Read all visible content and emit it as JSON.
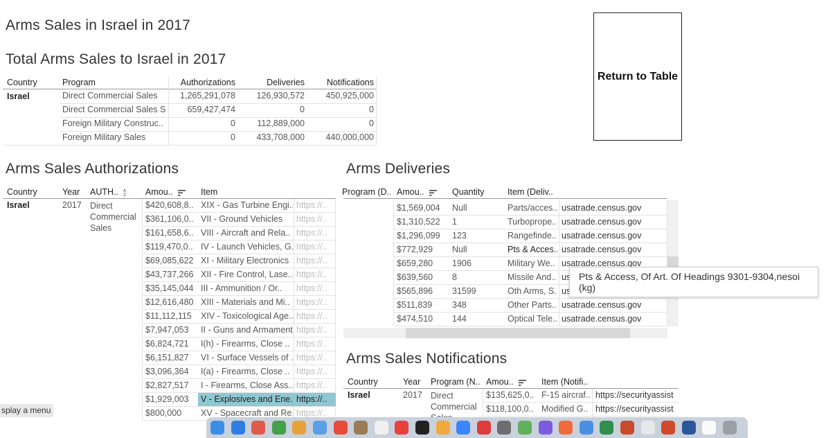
{
  "page_title": "Arms Sales in Israel in 2017",
  "return_button": "Return to Table",
  "total": {
    "title": "Total Arms Sales to Israel in 2017",
    "headers": [
      "Country",
      "Program",
      "Authorizations",
      "Deliveries",
      "Notifications"
    ],
    "country": "Israel",
    "rows": [
      {
        "program": "Direct Commercial Sales",
        "auth": "1,265,291,078",
        "deliv": "126,930,572",
        "notif": "450,925,000"
      },
      {
        "program": "Direct Commercial Sales S..",
        "auth": "659,427,474",
        "deliv": "0",
        "notif": "0"
      },
      {
        "program": "Foreign Military Construc..",
        "auth": "0",
        "deliv": "112,889,000",
        "notif": "0"
      },
      {
        "program": "Foreign Military Sales",
        "auth": "0",
        "deliv": "433,708,000",
        "notif": "440,000,000"
      }
    ]
  },
  "authorizations": {
    "title": "Arms Sales Authorizations",
    "headers": {
      "country": "Country",
      "year": "Year",
      "auth": "AUTH..",
      "amount": "Amou..",
      "item": "Item"
    },
    "country": "Israel",
    "year": "2017",
    "program_lines": [
      "Direct",
      "Commercial",
      "Sales"
    ],
    "rows": [
      {
        "amount": "$420,608,8..",
        "item": "XIX - Gas Turbine Engi..",
        "link": "https://.."
      },
      {
        "amount": "$361,106,0..",
        "item": "VII - Ground Vehicles",
        "link": "https://.."
      },
      {
        "amount": "$161,658,6..",
        "item": "VIII - Aircraft and Rela..",
        "link": "https://.."
      },
      {
        "amount": "$119,470,0..",
        "item": "IV - Launch Vehicles, G..",
        "link": "https://.."
      },
      {
        "amount": "$69,085,622",
        "item": "XI - Military Electronics",
        "link": "https://.."
      },
      {
        "amount": "$43,737,266",
        "item": "XII - Fire Control, Lase..",
        "link": "https://.."
      },
      {
        "amount": "$35,145,044",
        "item": "III - Ammunition / Or..",
        "link": "https://.."
      },
      {
        "amount": "$12,616,480",
        "item": "XIII - Materials and Mi..",
        "link": "https://.."
      },
      {
        "amount": "$11,112,115",
        "item": "XIV - Toxicological Age..",
        "link": "https://.."
      },
      {
        "amount": "$7,947,053",
        "item": "II - Guns and Armament",
        "link": "https://.."
      },
      {
        "amount": "$6,824,721",
        "item": "I(h) - Firearms, Close ..",
        "link": "https://.."
      },
      {
        "amount": "$6,151,827",
        "item": "VI - Surface Vessels of ..",
        "link": "https://.."
      },
      {
        "amount": "$3,096,364",
        "item": "I(a) - Firearms, Close ..",
        "link": "https://.."
      },
      {
        "amount": "$2,827,517",
        "item": "I - Firearms, Close Ass..",
        "link": "https://.."
      },
      {
        "amount": "$1,929,003",
        "item": "V - Explosives and Ene..",
        "link": "https://.."
      },
      {
        "amount": "$800,000",
        "item": "XV - Spacecraft and Re..",
        "link": "https://.."
      }
    ]
  },
  "deliveries": {
    "title": "Arms Deliveries",
    "headers": {
      "program": "Program (D..",
      "amount": "Amou..",
      "quantity": "Quantity",
      "item": "Item (Deliv.."
    },
    "rows": [
      {
        "amount": "$1,569,004",
        "qty": "Null",
        "item": "Parts/acces..",
        "source": "usatrade.census.gov"
      },
      {
        "amount": "$1,310,522",
        "qty": "1",
        "item": "Turboprope..",
        "source": "usatrade.census.gov"
      },
      {
        "amount": "$1,296,099",
        "qty": "123",
        "item": "Rangefinde..",
        "source": "usatrade.census.gov"
      },
      {
        "amount": "$772,929",
        "qty": "Null",
        "item": "Pts & Acces..",
        "source": "usatrade.census.gov"
      },
      {
        "amount": "$659,280",
        "qty": "1906",
        "item": "Military We..",
        "source": "usatrade.census.gov"
      },
      {
        "amount": "$639,560",
        "qty": "8",
        "item": "Missile And..",
        "source": "us"
      },
      {
        "amount": "$565,896",
        "qty": "31599",
        "item": "Oth Arms, S..",
        "source": "us"
      },
      {
        "amount": "$511,839",
        "qty": "348",
        "item": "Other Parts..",
        "source": "usatrade.census.gov"
      },
      {
        "amount": "$474,510",
        "qty": "144",
        "item": "Optical Tele..",
        "source": "usatrade.census.gov"
      }
    ]
  },
  "tooltip": "Pts & Access, Of Art. Of Headings 9301-9304,nesoi (kg)",
  "notifications": {
    "title": "Arms Sales Notifications",
    "headers": {
      "country": "Country",
      "year": "Year",
      "program": "Program (N..",
      "amount": "Amou..",
      "item": "Item (Notifi.."
    },
    "country": "Israel",
    "year": "2017",
    "program_lines": [
      "Direct",
      "Commercial",
      "Sales"
    ],
    "rows": [
      {
        "amount": "$135,625,0..",
        "item": "F-15 aircraf..",
        "link": "https://securityassist"
      },
      {
        "amount": "$118,100,0..",
        "item": "Modified G..",
        "link": "https://securityassist"
      }
    ]
  },
  "menu_hint": "splay a menu",
  "dock_colors": [
    "#3b8ee8",
    "#2f7de0",
    "#e05a4a",
    "#45a04a",
    "#e8a23a",
    "#5aa0e8",
    "#e64c3c",
    "#9a7b55",
    "#f0f0f0",
    "#e8413c",
    "#222222",
    "#f2a93b",
    "#3a86ff",
    "#e03b3b",
    "#6e6e6e",
    "#5fb15a",
    "#7b5be0",
    "#f06b3a",
    "#4a90e2",
    "#2f8f4e",
    "#c84a2a",
    "#e8e8e8",
    "#d04a2a",
    "#2b579a",
    "#fafafa",
    "#9aa0a6"
  ]
}
